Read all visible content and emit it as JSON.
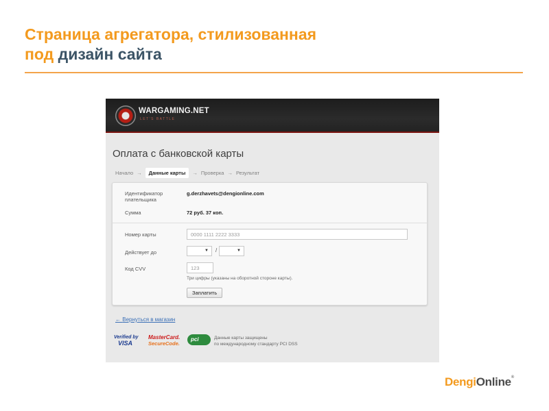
{
  "slide": {
    "title_line1": "Страница агрегатора, стилизованная",
    "title_line2_accent": "под",
    "title_line2_rest": " дизайн сайта"
  },
  "brand": {
    "part1": "Dengi",
    "part2": "Online",
    "mark": "®"
  },
  "screenshot": {
    "header": {
      "logo_text": "WARGAMING.NET",
      "logo_tagline": "LET'S BATTLE"
    },
    "page_heading": "Оплата с банковской карты",
    "steps": [
      {
        "label": "Начало"
      },
      {
        "label": "Данные карты",
        "active": true
      },
      {
        "label": "Проверка"
      },
      {
        "label": "Результат"
      }
    ],
    "step_separator": "→",
    "form": {
      "payer_label": "Идентификатор плательщика",
      "payer_value": "g.derzhavets@dengionline.com",
      "amount_label": "Сумма",
      "amount_value": "72 руб. 37 коп.",
      "card_number_label": "Номер карты",
      "card_number_placeholder": "0000 1111 2222 3333",
      "expiry_label": "Действует до",
      "expiry_month": "",
      "expiry_year": "",
      "expiry_separator": "/",
      "cvv_label": "Код CVV",
      "cvv_placeholder": "123",
      "cvv_hint": "Три цифры (указаны на оборотной стороне карты).",
      "pay_button": "Заплатить"
    },
    "back_link": {
      "arrow": "←",
      "label": "Вернуться в магазин"
    },
    "badges": {
      "visa_line1": "Verified by",
      "visa_line2": "VISA",
      "mastercard_line1": "MasterCard.",
      "mastercard_line2": "SecureCode.",
      "pci_logo": "pci",
      "pci_text_line1": "Данные карты защищены",
      "pci_text_line2": "по международному стандарту PCI DSS"
    }
  },
  "colors": {
    "accent_orange": "#f39a1e",
    "title_dark": "#3c5466",
    "link_blue": "#3a6fb6",
    "wg_red": "#b51f15"
  }
}
